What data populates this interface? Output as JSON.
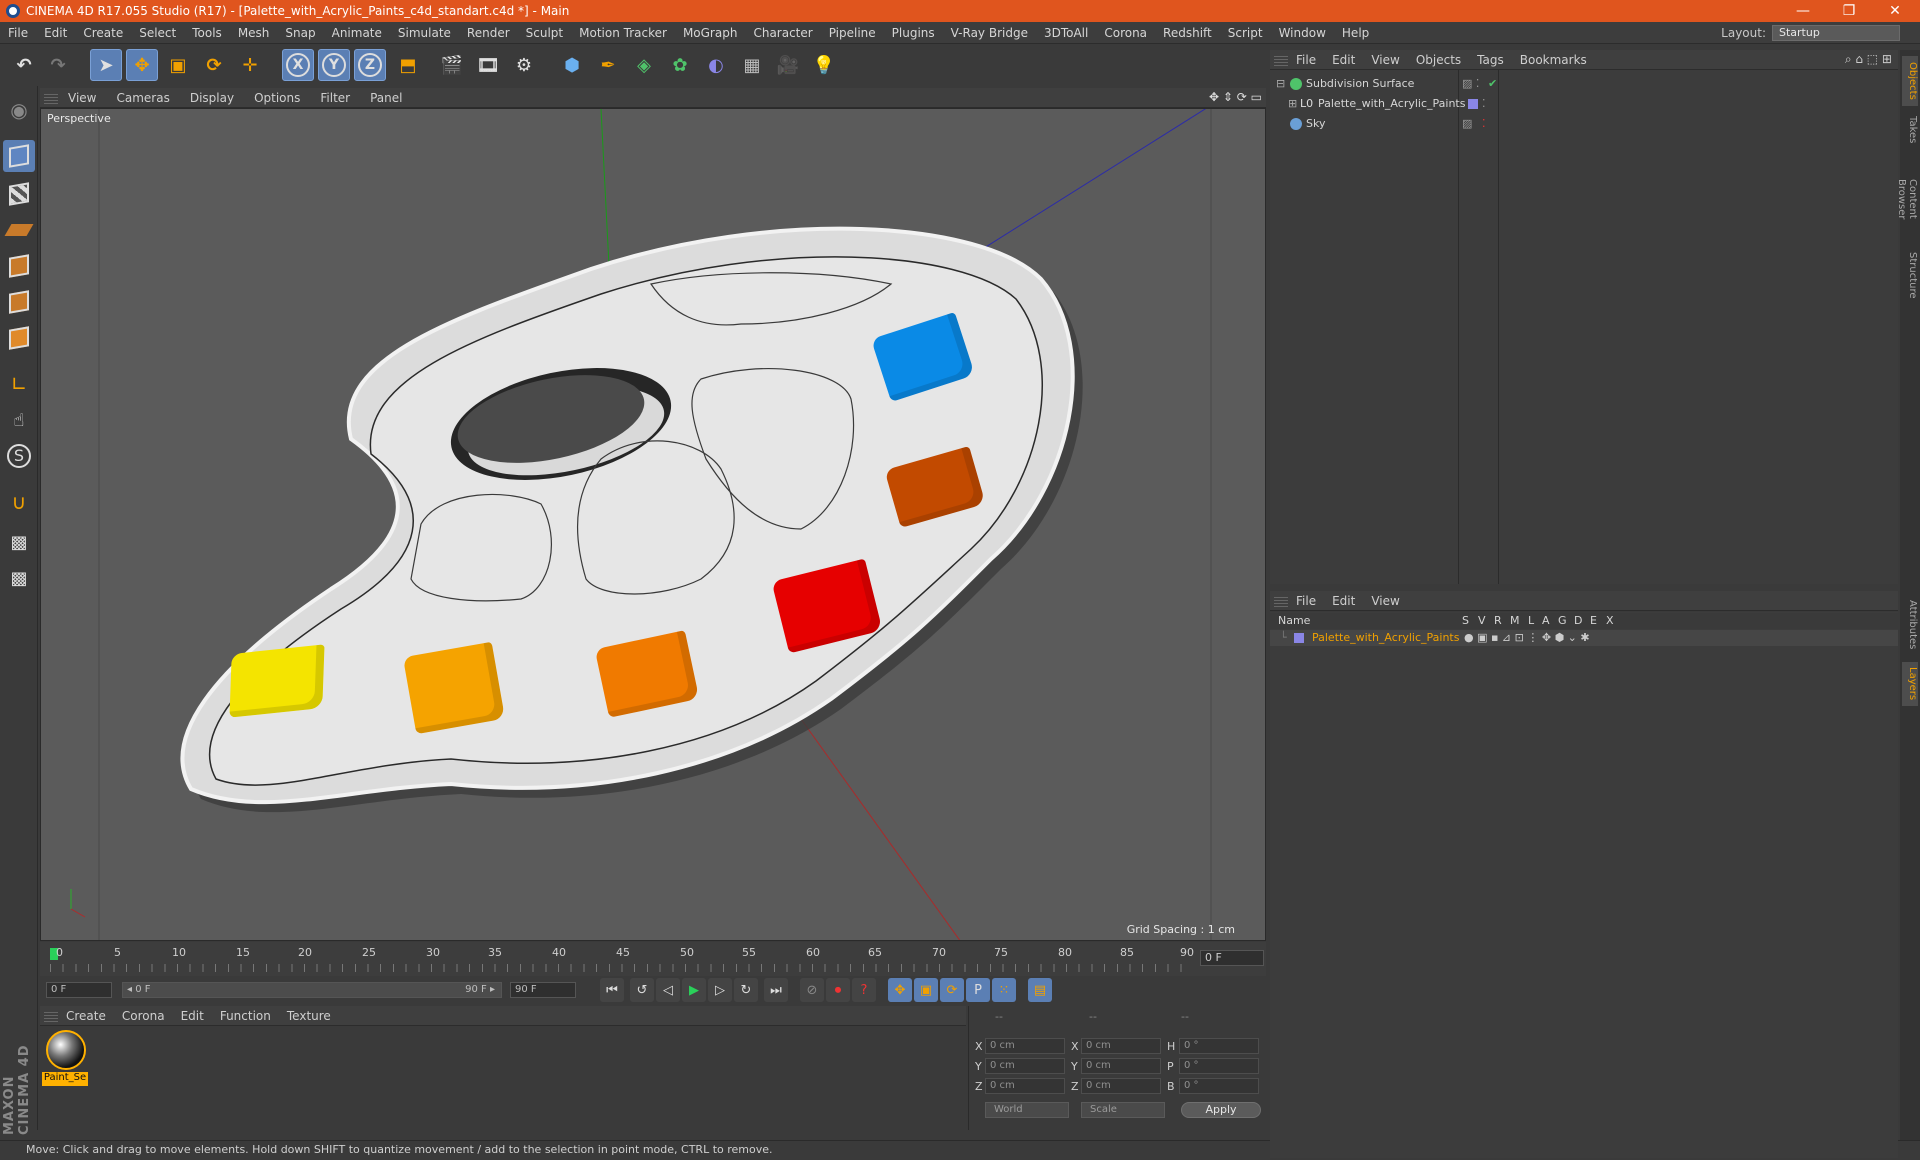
{
  "window": {
    "title": "CINEMA 4D R17.055 Studio (R17) - [Palette_with_Acrylic_Paints_c4d_standart.c4d *] - Main",
    "minimize": "—",
    "restore": "❐",
    "close": "✕"
  },
  "menu": [
    "File",
    "Edit",
    "Create",
    "Select",
    "Tools",
    "Mesh",
    "Snap",
    "Animate",
    "Simulate",
    "Render",
    "Sculpt",
    "Motion Tracker",
    "MoGraph",
    "Character",
    "Pipeline",
    "Plugins",
    "V-Ray Bridge",
    "3DToAll",
    "Corona",
    "Redshift",
    "Script",
    "Window",
    "Help"
  ],
  "layout": {
    "label": "Layout:",
    "value": "Startup"
  },
  "toolbar": {
    "x_axis": "X",
    "y_axis": "Y",
    "z_axis": "Z"
  },
  "viewport": {
    "menu": [
      "View",
      "Cameras",
      "Display",
      "Options",
      "Filter",
      "Panel"
    ],
    "label": "Perspective",
    "grid_spacing": "Grid Spacing : 1 cm"
  },
  "timeline": {
    "ticks": [
      "0",
      "5",
      "10",
      "15",
      "20",
      "25",
      "30",
      "35",
      "40",
      "45",
      "50",
      "55",
      "60",
      "65",
      "70",
      "75",
      "80",
      "85",
      "90"
    ],
    "current_frame": "0 F"
  },
  "transport": {
    "start": "0 F",
    "range_start": "◂ 0 F",
    "range_end": "90 F ▸",
    "end": "90 F"
  },
  "materials": {
    "menu": [
      "Create",
      "Corona",
      "Edit",
      "Function",
      "Texture"
    ],
    "items": [
      {
        "name": "Paint_Se"
      }
    ]
  },
  "coordinates": {
    "header": [
      "--",
      "--",
      "--"
    ],
    "rows": [
      {
        "a": "X",
        "av": "0 cm",
        "b": "X",
        "bv": "0 cm",
        "c": "H",
        "cv": "0 °"
      },
      {
        "a": "Y",
        "av": "0 cm",
        "b": "Y",
        "bv": "0 cm",
        "c": "P",
        "cv": "0 °"
      },
      {
        "a": "Z",
        "av": "0 cm",
        "b": "Z",
        "bv": "0 cm",
        "c": "B",
        "cv": "0 °"
      }
    ],
    "mode": "World",
    "scale": "Scale",
    "apply": "Apply"
  },
  "status": "Move: Click and drag to move elements. Hold down SHIFT to quantize movement / add to the selection in point mode, CTRL to remove.",
  "objects": {
    "menu": [
      "File",
      "Edit",
      "View",
      "Objects",
      "Tags",
      "Bookmarks"
    ],
    "items": [
      {
        "name": "Subdivision Surface",
        "color": "#4fc36a"
      },
      {
        "name": "Palette_with_Acrylic_Paints",
        "color": "#9a9a9a"
      },
      {
        "name": "Sky",
        "color": "#6a9fd6"
      }
    ]
  },
  "layers": {
    "menu": [
      "File",
      "Edit",
      "View"
    ],
    "columns": [
      "Name",
      "S",
      "V",
      "R",
      "M",
      "L",
      "A",
      "G",
      "D",
      "E",
      "X"
    ],
    "items": [
      {
        "name": "Palette_with_Acrylic_Paints",
        "color": "#f0a000"
      }
    ]
  },
  "right_tabs": [
    "Objects",
    "Takes",
    "Content Browser",
    "Structure",
    "Attributes",
    "Layers"
  ],
  "brand": "MAXON CINEMA 4D",
  "paints": [
    {
      "name": "yellow",
      "color": "#f4e400"
    },
    {
      "name": "light-orange",
      "color": "#f5a300"
    },
    {
      "name": "orange",
      "color": "#f07a00"
    },
    {
      "name": "red",
      "color": "#e60000"
    },
    {
      "name": "brown",
      "color": "#c24a00"
    },
    {
      "name": "blue",
      "color": "#0a8ae6"
    }
  ]
}
